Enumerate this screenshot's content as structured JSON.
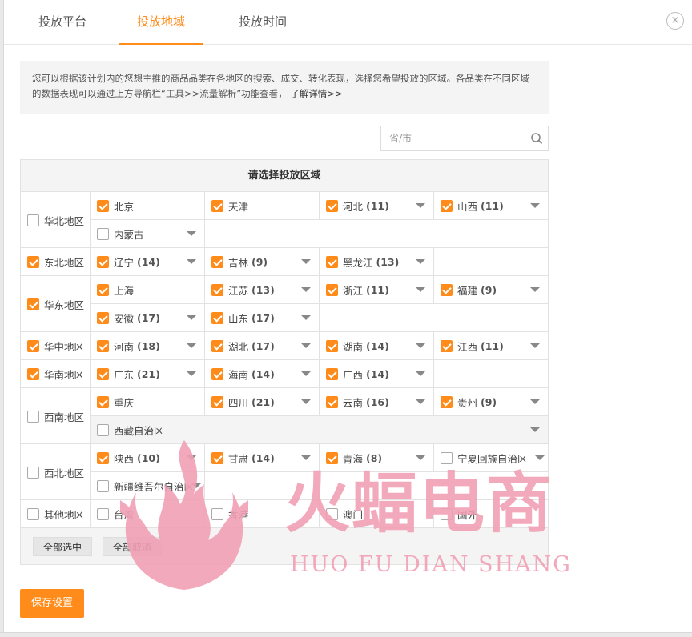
{
  "tabs": [
    {
      "label": "投放平台"
    },
    {
      "label": "投放地域"
    },
    {
      "label": "投放时间"
    }
  ],
  "close_label": "×",
  "notice": {
    "text": "您可以根据该计划内的您想主推的商品品类在各地区的搜索、成交、转化表现，选择您希望投放的区域。各品类在不同区域的数据表现可以通过上方导航栏“工具>>流量解析”功能查看，",
    "link": "了解详情>>"
  },
  "search": {
    "placeholder": "省/市"
  },
  "table": {
    "title": "请选择投放区域"
  },
  "regions": [
    {
      "label": "华北地区",
      "checked": false,
      "provinces": [
        {
          "name": "北京",
          "count": "",
          "checked": true,
          "dropdown": false
        },
        {
          "name": "天津",
          "count": "",
          "checked": true,
          "dropdown": false
        },
        {
          "name": "河北",
          "count": "(11)",
          "checked": true,
          "dropdown": true
        },
        {
          "name": "山西",
          "count": "(11)",
          "checked": true,
          "dropdown": true
        },
        {
          "name": "内蒙古",
          "count": "",
          "checked": false,
          "dropdown": true
        }
      ]
    },
    {
      "label": "东北地区",
      "checked": true,
      "provinces": [
        {
          "name": "辽宁",
          "count": "(14)",
          "checked": true,
          "dropdown": true
        },
        {
          "name": "吉林",
          "count": "(9)",
          "checked": true,
          "dropdown": true
        },
        {
          "name": "黑龙江",
          "count": "(13)",
          "checked": true,
          "dropdown": true
        }
      ]
    },
    {
      "label": "华东地区",
      "checked": true,
      "provinces": [
        {
          "name": "上海",
          "count": "",
          "checked": true,
          "dropdown": false
        },
        {
          "name": "江苏",
          "count": "(13)",
          "checked": true,
          "dropdown": true
        },
        {
          "name": "浙江",
          "count": "(11)",
          "checked": true,
          "dropdown": true
        },
        {
          "name": "福建",
          "count": "(9)",
          "checked": true,
          "dropdown": true
        },
        {
          "name": "安徽",
          "count": "(17)",
          "checked": true,
          "dropdown": true
        },
        {
          "name": "山东",
          "count": "(17)",
          "checked": true,
          "dropdown": true
        }
      ]
    },
    {
      "label": "华中地区",
      "checked": true,
      "provinces": [
        {
          "name": "河南",
          "count": "(18)",
          "checked": true,
          "dropdown": true
        },
        {
          "name": "湖北",
          "count": "(17)",
          "checked": true,
          "dropdown": true
        },
        {
          "name": "湖南",
          "count": "(14)",
          "checked": true,
          "dropdown": true
        },
        {
          "name": "江西",
          "count": "(11)",
          "checked": true,
          "dropdown": true
        }
      ]
    },
    {
      "label": "华南地区",
      "checked": true,
      "provinces": [
        {
          "name": "广东",
          "count": "(21)",
          "checked": true,
          "dropdown": true
        },
        {
          "name": "海南",
          "count": "(14)",
          "checked": true,
          "dropdown": true
        },
        {
          "name": "广西",
          "count": "(14)",
          "checked": true,
          "dropdown": true
        }
      ]
    },
    {
      "label": "西南地区",
      "checked": false,
      "provinces": [
        {
          "name": "重庆",
          "count": "",
          "checked": true,
          "dropdown": false
        },
        {
          "name": "四川",
          "count": "(21)",
          "checked": true,
          "dropdown": true
        },
        {
          "name": "云南",
          "count": "(16)",
          "checked": true,
          "dropdown": true
        },
        {
          "name": "贵州",
          "count": "(9)",
          "checked": true,
          "dropdown": true
        },
        {
          "name": "西藏自治区",
          "count": "",
          "checked": false,
          "dropdown": true
        }
      ]
    },
    {
      "label": "西北地区",
      "checked": false,
      "provinces": [
        {
          "name": "陕西",
          "count": "(10)",
          "checked": true,
          "dropdown": true
        },
        {
          "name": "甘肃",
          "count": "(14)",
          "checked": true,
          "dropdown": true
        },
        {
          "name": "青海",
          "count": "(8)",
          "checked": true,
          "dropdown": true
        },
        {
          "name": "宁夏回族自治区",
          "count": "",
          "checked": false,
          "dropdown": true
        },
        {
          "name": "新疆维吾尔自治区",
          "count": "",
          "checked": false,
          "dropdown": true
        }
      ]
    },
    {
      "label": "其他地区",
      "checked": false,
      "provinces": [
        {
          "name": "台湾",
          "count": "",
          "checked": false,
          "dropdown": false
        },
        {
          "name": "香港",
          "count": "",
          "checked": false,
          "dropdown": false
        },
        {
          "name": "澳门",
          "count": "",
          "checked": false,
          "dropdown": false
        },
        {
          "name": "国外",
          "count": "",
          "checked": false,
          "dropdown": false
        }
      ]
    }
  ],
  "buttons": {
    "select_all": "全部选中",
    "deselect_all": "全部取消",
    "save": "保存设置"
  },
  "watermark": {
    "title": "火蝠电商",
    "subtitle": "HUO FU DIAN SHANG",
    "color": "#f2a0b5"
  },
  "colors": {
    "accent": "#ff8c1a"
  }
}
